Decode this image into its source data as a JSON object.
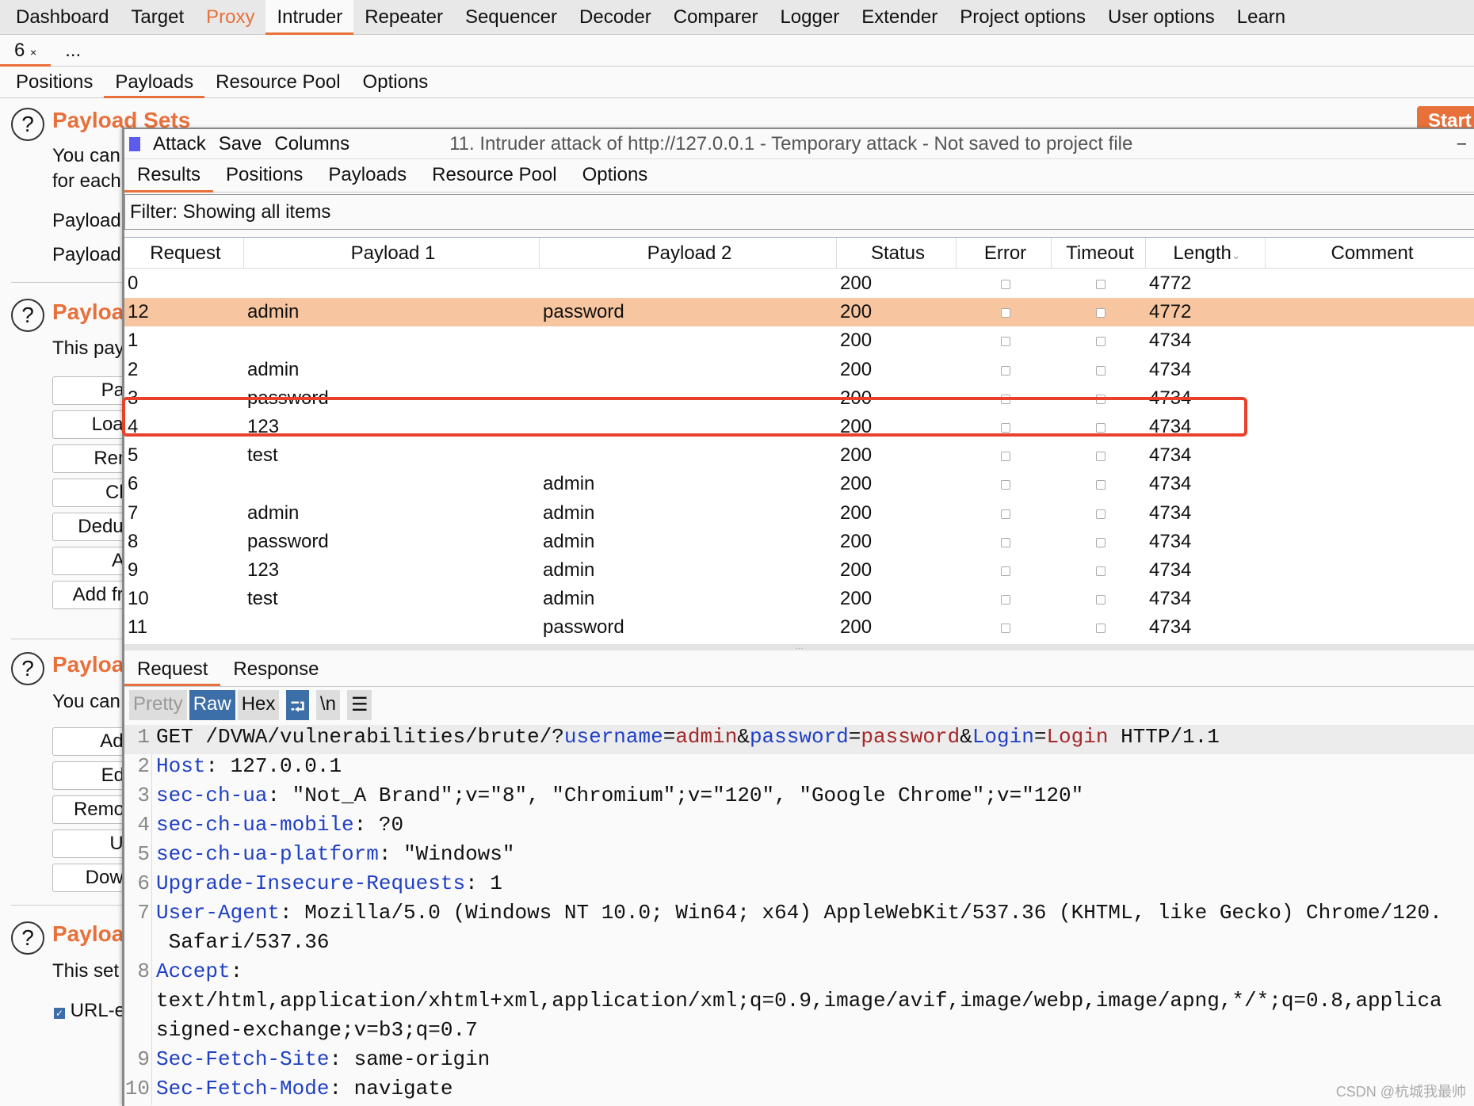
{
  "top_tabs": [
    "Dashboard",
    "Target",
    "Proxy",
    "Intruder",
    "Repeater",
    "Sequencer",
    "Decoder",
    "Comparer",
    "Logger",
    "Extender",
    "Project options",
    "User options",
    "Learn"
  ],
  "attack_tabs": {
    "tab": "6",
    "close": "×",
    "more": "..."
  },
  "sub_tabs": [
    "Positions",
    "Payloads",
    "Resource Pool",
    "Options"
  ],
  "left": {
    "h1": "Payload Sets",
    "p1a": "You can",
    "p1b": "for each",
    "p1c": "Payload",
    "p1d": "Payload",
    "h2": "Payloa",
    "p2": "This pay",
    "buttons2": [
      "Pas",
      "Load",
      "Rem",
      "Cle",
      "Dedup",
      "Ac",
      "Add fro"
    ],
    "h3": "Payloa",
    "p3": "You can",
    "buttons3": [
      "Add",
      "Edit",
      "Remov",
      "Up",
      "Down"
    ],
    "h4": "Payloa",
    "p4": "This set",
    "check": "URL-e",
    "start": "Start"
  },
  "window": {
    "menu": [
      "Attack",
      "Save",
      "Columns"
    ],
    "title": "11. Intruder attack of http://127.0.0.1 - Temporary attack - Not saved to project file",
    "minimize": "–",
    "tabs": [
      "Results",
      "Positions",
      "Payloads",
      "Resource Pool",
      "Options"
    ],
    "filter": "Filter: Showing all items"
  },
  "table": {
    "columns": [
      "Request",
      "Payload 1",
      "Payload 2",
      "Status",
      "Error",
      "Timeout",
      "Length",
      "Comment"
    ],
    "sort_indicator": "⌄",
    "rows": [
      [
        "0",
        "",
        "",
        "200",
        "",
        "",
        "4772",
        ""
      ],
      [
        "12",
        "admin",
        "password",
        "200",
        "",
        "",
        "4772",
        ""
      ],
      [
        "1",
        "",
        "",
        "200",
        "",
        "",
        "4734",
        ""
      ],
      [
        "2",
        "admin",
        "",
        "200",
        "",
        "",
        "4734",
        ""
      ],
      [
        "3",
        "password",
        "",
        "200",
        "",
        "",
        "4734",
        ""
      ],
      [
        "4",
        "123",
        "",
        "200",
        "",
        "",
        "4734",
        ""
      ],
      [
        "5",
        "test",
        "",
        "200",
        "",
        "",
        "4734",
        ""
      ],
      [
        "6",
        "",
        "admin",
        "200",
        "",
        "",
        "4734",
        ""
      ],
      [
        "7",
        "admin",
        "admin",
        "200",
        "",
        "",
        "4734",
        ""
      ],
      [
        "8",
        "password",
        "admin",
        "200",
        "",
        "",
        "4734",
        ""
      ],
      [
        "9",
        "123",
        "admin",
        "200",
        "",
        "",
        "4734",
        ""
      ],
      [
        "10",
        "test",
        "admin",
        "200",
        "",
        "",
        "4734",
        ""
      ],
      [
        "11",
        "",
        "password",
        "200",
        "",
        "",
        "4734",
        ""
      ]
    ],
    "selected_row": 1,
    "highlight_color": "#f7c59f",
    "box_color": "#e8402a"
  },
  "detail": {
    "tabs": [
      "Request",
      "Response"
    ],
    "tools": [
      "Pretty",
      "Raw",
      "Hex",
      "⮒",
      "\\n",
      "☰"
    ],
    "splitter": "···",
    "lines": [
      {
        "n": "1",
        "parts": [
          [
            "",
            "GET /DVWA/vulnerabilities/brute/?"
          ],
          [
            "k",
            "username"
          ],
          [
            "",
            "="
          ],
          [
            "v",
            "admin"
          ],
          [
            "",
            "&"
          ],
          [
            "k",
            "password"
          ],
          [
            "",
            "="
          ],
          [
            "v",
            "password"
          ],
          [
            "",
            "&"
          ],
          [
            "k",
            "Login"
          ],
          [
            "",
            "="
          ],
          [
            "v",
            "Login"
          ],
          [
            "",
            " HTTP/1.1"
          ]
        ]
      },
      {
        "n": "2",
        "parts": [
          [
            "k",
            "Host"
          ],
          [
            "",
            ": 127.0.0.1"
          ]
        ]
      },
      {
        "n": "3",
        "parts": [
          [
            "k",
            "sec-ch-ua"
          ],
          [
            "",
            ": \"Not_A Brand\";v=\"8\", \"Chromium\";v=\"120\", \"Google Chrome\";v=\"120\""
          ]
        ]
      },
      {
        "n": "4",
        "parts": [
          [
            "k",
            "sec-ch-ua-mobile"
          ],
          [
            "",
            ": ?0"
          ]
        ]
      },
      {
        "n": "5",
        "parts": [
          [
            "k",
            "sec-ch-ua-platform"
          ],
          [
            "",
            ": \"Windows\""
          ]
        ]
      },
      {
        "n": "6",
        "parts": [
          [
            "k",
            "Upgrade-Insecure-Requests"
          ],
          [
            "",
            ": 1"
          ]
        ]
      },
      {
        "n": "7",
        "parts": [
          [
            "k",
            "User-Agent"
          ],
          [
            "",
            ": Mozilla/5.0 (Windows NT 10.0; Win64; x64) AppleWebKit/537.36 (KHTML, like Gecko) Chrome/120."
          ]
        ]
      },
      {
        "n": "",
        "parts": [
          [
            "",
            " Safari/537.36"
          ]
        ]
      },
      {
        "n": "8",
        "parts": [
          [
            "k",
            "Accept"
          ],
          [
            "",
            ":"
          ]
        ]
      },
      {
        "n": "",
        "parts": [
          [
            "",
            "text/html,application/xhtml+xml,application/xml;q=0.9,image/avif,image/webp,image/apng,*/*;q=0.8,applica"
          ]
        ]
      },
      {
        "n": "",
        "parts": [
          [
            "",
            "signed-exchange;v=b3;q=0.7"
          ]
        ]
      },
      {
        "n": "9",
        "parts": [
          [
            "k",
            "Sec-Fetch-Site"
          ],
          [
            "",
            ": same-origin"
          ]
        ]
      },
      {
        "n": "10",
        "parts": [
          [
            "k",
            "Sec-Fetch-Mode"
          ],
          [
            "",
            ": navigate"
          ]
        ]
      }
    ]
  },
  "watermark": "CSDN @杭城我最帅"
}
